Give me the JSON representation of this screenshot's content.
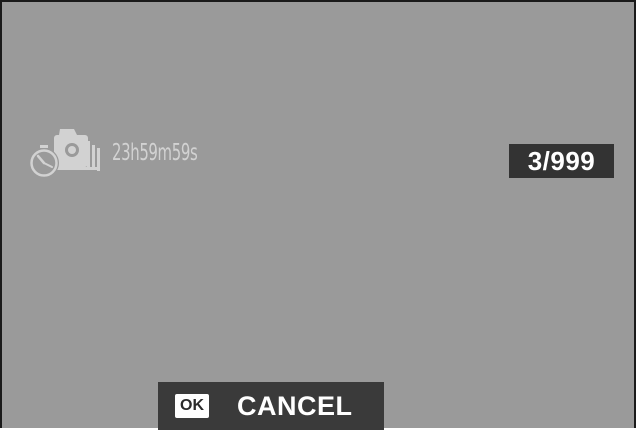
{
  "status": {
    "mode_icon": "interval-timer-shooting-icon",
    "countdown": "23h59m59s",
    "frame_counter": "3/999"
  },
  "footer": {
    "ok_key": "OK",
    "cancel_label": "CANCEL"
  },
  "colors": {
    "screen_background": "#9a9a9a",
    "icon_and_countdown": "#d2d2d2",
    "counter_background": "#333333",
    "bar_background": "#3a3a3a"
  }
}
